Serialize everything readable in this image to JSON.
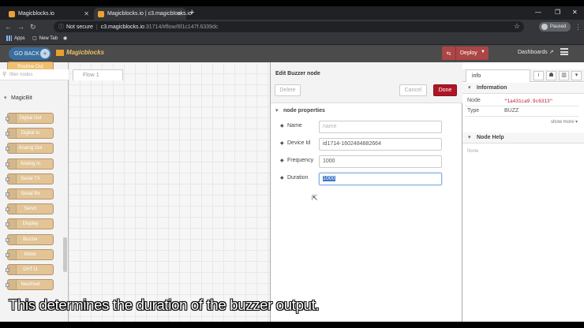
{
  "browser": {
    "tabs": [
      {
        "title": "Magicblocks.io",
        "active": false
      },
      {
        "title": "Magicblocks.io | c3.magicblocks.io",
        "active": true
      }
    ],
    "security": "Not secure",
    "url_host": "c3.magicblocks.io",
    "url_rest": ":31714/#flow/6f1c147f.6339dc",
    "profile": "Paused",
    "bookmarks": [
      "Apps",
      "New Tab"
    ]
  },
  "header": {
    "go_back": "GO BACK",
    "logo": "Magicblocks",
    "deploy": "Deploy",
    "dashboards": "Dashboards"
  },
  "palette": {
    "filter_placeholder": "filter nodes",
    "partial_node": "Positive Out",
    "category": "MagicBit",
    "nodes": [
      "Digital Out",
      "Digital In",
      "Analog Out",
      "Analog In",
      "Serial TX",
      "Serial Rx",
      "Servo",
      "Display",
      "Buzzer",
      "Motor",
      "DHT11",
      "NeoPixel"
    ]
  },
  "workspace": {
    "flow_tab": "Flow 1"
  },
  "editor": {
    "title": "Edit Buzzer node",
    "delete": "Delete",
    "cancel": "Cancel",
    "done": "Done",
    "section": "node properties",
    "fields": {
      "name": {
        "label": "Name",
        "placeholder": "name",
        "value": ""
      },
      "device_id": {
        "label": "Device Id",
        "value": "id1714-1602484882664"
      },
      "frequency": {
        "label": "Frequency",
        "value": "1000"
      },
      "duration": {
        "label": "Duration",
        "value": "1000"
      }
    }
  },
  "sidebar": {
    "tab": "info",
    "info_heading": "Information",
    "rows": [
      {
        "key": "Node",
        "value": "\"1a431ca9.9c6313\""
      },
      {
        "key": "Type",
        "value": "BUZZ"
      }
    ],
    "show_more": "show more",
    "help_heading": "Node Help",
    "help_text": "None"
  },
  "caption": "This determines the duration of the buzzer output."
}
